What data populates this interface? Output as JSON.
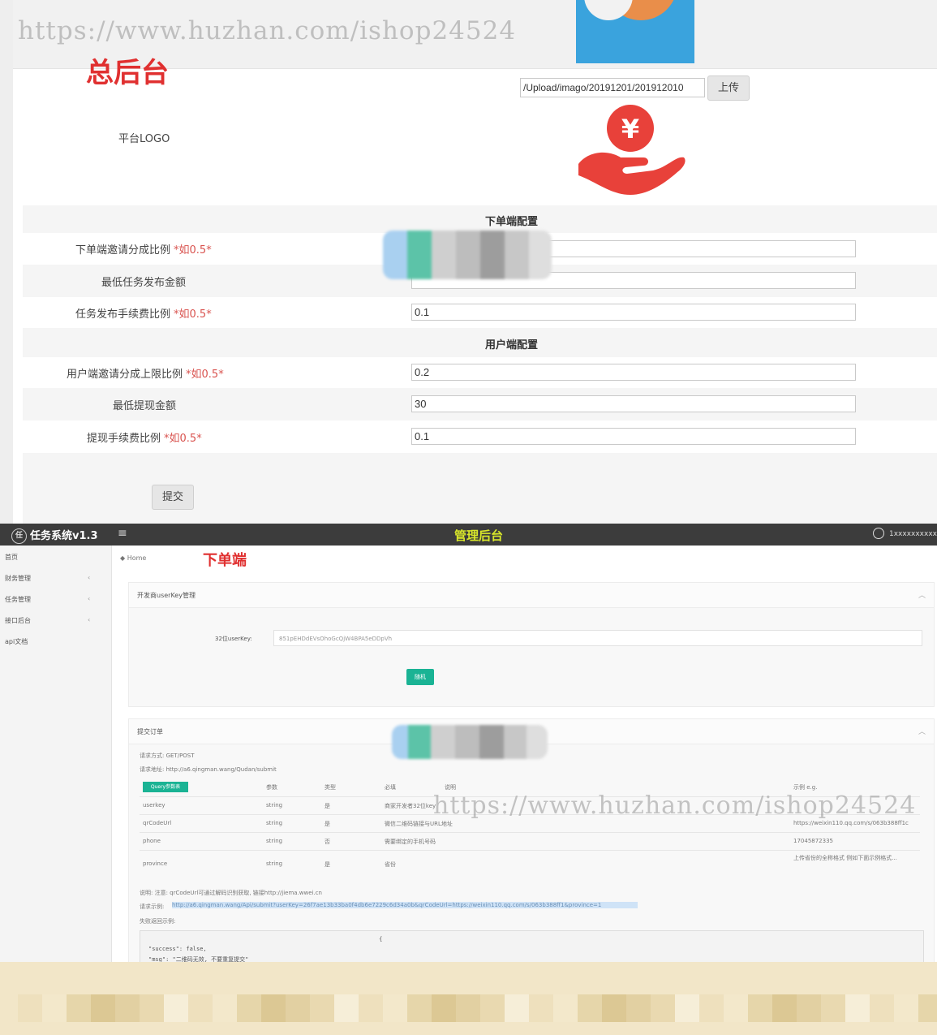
{
  "top": {
    "watermark": "https://www.huzhan.com/ishop24524",
    "red_title": "总后台",
    "logo_row": {
      "label": "平台LOGO",
      "path_value": "/Upload/imago/20191201/201912010",
      "upload_button": "上传"
    },
    "section_order": "下单端配置",
    "order_rows": [
      {
        "label": "下单端邀请分成比例",
        "hint": "*如0.5*",
        "value": ""
      },
      {
        "label": "最低任务发布金额",
        "hint": "",
        "value": ""
      },
      {
        "label": "任务发布手续费比例",
        "hint": "*如0.5*",
        "value": "0.1"
      }
    ],
    "section_user": "用户端配置",
    "user_rows": [
      {
        "label": "用户端邀请分成上限比例",
        "hint": "*如0.5*",
        "value": "0.2"
      },
      {
        "label": "最低提现金额",
        "hint": "",
        "value": "30"
      },
      {
        "label": "提现手续费比例",
        "hint": "*如0.5*",
        "value": "0.1"
      }
    ],
    "submit_button": "提交"
  },
  "bottom": {
    "brand": "任务系统v1.3",
    "menu_icon": "≡",
    "nav_title": "管理后台",
    "username": "1xxxxxxxxxx",
    "sidebar": [
      "首页",
      "财务管理",
      "任务管理",
      "接口后台",
      "api文档"
    ],
    "breadcrumb": "Home",
    "red_title": "下单端",
    "key_panel": {
      "title": "开发商userKey管理",
      "label": "32位userKey:",
      "value": "851pEHDdEVsOhoGcQjW4BPA5eDDpVh",
      "button": "随机"
    },
    "order_panel": {
      "title": "提交订单",
      "method": "请求方式: GET/POST",
      "url": "请求地址: http://a6.qingman.wang/Qudan/submit",
      "tag": "Query参数表",
      "headers": [
        "参数",
        "类型",
        "必填",
        "说明",
        "示例 e.g."
      ],
      "rows": [
        {
          "param": "userkey",
          "type": "string",
          "required": "是",
          "desc": "商家开发者32位key",
          "example": ""
        },
        {
          "param": "qrCodeUrl",
          "type": "string",
          "required": "是",
          "desc": "微信二维码链接与URL地址",
          "example": "https://weixin110.qq.com/s/063b388ff1c"
        },
        {
          "param": "phone",
          "type": "string",
          "required": "否",
          "desc": "需要绑定的手机号码",
          "example": "17045872335"
        },
        {
          "param": "province",
          "type": "string",
          "required": "是",
          "desc": "省份",
          "example": "上传省份的全称格式 例如下面示例格式..."
        }
      ],
      "note": "说明: 注意: qrCodeUrl可通过解码识别获取, 链接http://jiema.wwei.cn",
      "full_url_label": "请求示例:",
      "full_url": "http://a6.qingman.wang/Api/submit?userKey=26f7ae13b33ba0f4db6e7229c6d34a0b&qrCodeUrl=https://weixin110.qq.com/s/063b388ff1&province=1",
      "return_label": "失败返回示例:",
      "code_line1": "\"success\": false,",
      "code_line2": "\"msg\": \"二维码无效, 不要重复提交\"",
      "code_brace": "{"
    },
    "watermark": "https://www.huzhan.com/ishop24524"
  },
  "colors": {
    "nav_bg": "#3c3c3c",
    "nav_title": "#d8e62a",
    "red_title": "#e03030",
    "button_green": "#1ab394",
    "hint_red": "#d9534f",
    "mosaic_bg": "#f2e6c8"
  }
}
